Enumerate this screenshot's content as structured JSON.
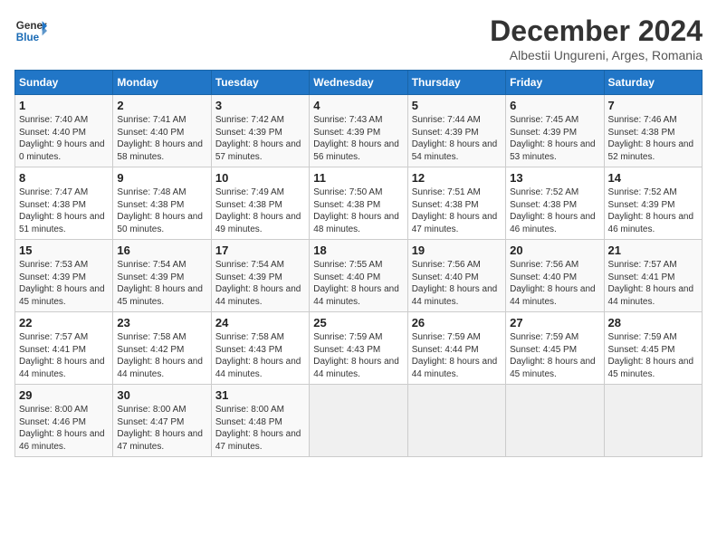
{
  "header": {
    "logo_line1": "General",
    "logo_line2": "Blue",
    "month": "December 2024",
    "location": "Albestii Ungureni, Arges, Romania"
  },
  "columns": [
    "Sunday",
    "Monday",
    "Tuesday",
    "Wednesday",
    "Thursday",
    "Friday",
    "Saturday"
  ],
  "weeks": [
    [
      {
        "day": 1,
        "sunrise": "7:40 AM",
        "sunset": "4:40 PM",
        "daylight": "9 hours and 0 minutes."
      },
      {
        "day": 2,
        "sunrise": "7:41 AM",
        "sunset": "4:40 PM",
        "daylight": "8 hours and 58 minutes."
      },
      {
        "day": 3,
        "sunrise": "7:42 AM",
        "sunset": "4:39 PM",
        "daylight": "8 hours and 57 minutes."
      },
      {
        "day": 4,
        "sunrise": "7:43 AM",
        "sunset": "4:39 PM",
        "daylight": "8 hours and 56 minutes."
      },
      {
        "day": 5,
        "sunrise": "7:44 AM",
        "sunset": "4:39 PM",
        "daylight": "8 hours and 54 minutes."
      },
      {
        "day": 6,
        "sunrise": "7:45 AM",
        "sunset": "4:39 PM",
        "daylight": "8 hours and 53 minutes."
      },
      {
        "day": 7,
        "sunrise": "7:46 AM",
        "sunset": "4:38 PM",
        "daylight": "8 hours and 52 minutes."
      }
    ],
    [
      {
        "day": 8,
        "sunrise": "7:47 AM",
        "sunset": "4:38 PM",
        "daylight": "8 hours and 51 minutes."
      },
      {
        "day": 9,
        "sunrise": "7:48 AM",
        "sunset": "4:38 PM",
        "daylight": "8 hours and 50 minutes."
      },
      {
        "day": 10,
        "sunrise": "7:49 AM",
        "sunset": "4:38 PM",
        "daylight": "8 hours and 49 minutes."
      },
      {
        "day": 11,
        "sunrise": "7:50 AM",
        "sunset": "4:38 PM",
        "daylight": "8 hours and 48 minutes."
      },
      {
        "day": 12,
        "sunrise": "7:51 AM",
        "sunset": "4:38 PM",
        "daylight": "8 hours and 47 minutes."
      },
      {
        "day": 13,
        "sunrise": "7:52 AM",
        "sunset": "4:38 PM",
        "daylight": "8 hours and 46 minutes."
      },
      {
        "day": 14,
        "sunrise": "7:52 AM",
        "sunset": "4:39 PM",
        "daylight": "8 hours and 46 minutes."
      }
    ],
    [
      {
        "day": 15,
        "sunrise": "7:53 AM",
        "sunset": "4:39 PM",
        "daylight": "8 hours and 45 minutes."
      },
      {
        "day": 16,
        "sunrise": "7:54 AM",
        "sunset": "4:39 PM",
        "daylight": "8 hours and 45 minutes."
      },
      {
        "day": 17,
        "sunrise": "7:54 AM",
        "sunset": "4:39 PM",
        "daylight": "8 hours and 44 minutes."
      },
      {
        "day": 18,
        "sunrise": "7:55 AM",
        "sunset": "4:40 PM",
        "daylight": "8 hours and 44 minutes."
      },
      {
        "day": 19,
        "sunrise": "7:56 AM",
        "sunset": "4:40 PM",
        "daylight": "8 hours and 44 minutes."
      },
      {
        "day": 20,
        "sunrise": "7:56 AM",
        "sunset": "4:40 PM",
        "daylight": "8 hours and 44 minutes."
      },
      {
        "day": 21,
        "sunrise": "7:57 AM",
        "sunset": "4:41 PM",
        "daylight": "8 hours and 44 minutes."
      }
    ],
    [
      {
        "day": 22,
        "sunrise": "7:57 AM",
        "sunset": "4:41 PM",
        "daylight": "8 hours and 44 minutes."
      },
      {
        "day": 23,
        "sunrise": "7:58 AM",
        "sunset": "4:42 PM",
        "daylight": "8 hours and 44 minutes."
      },
      {
        "day": 24,
        "sunrise": "7:58 AM",
        "sunset": "4:43 PM",
        "daylight": "8 hours and 44 minutes."
      },
      {
        "day": 25,
        "sunrise": "7:59 AM",
        "sunset": "4:43 PM",
        "daylight": "8 hours and 44 minutes."
      },
      {
        "day": 26,
        "sunrise": "7:59 AM",
        "sunset": "4:44 PM",
        "daylight": "8 hours and 44 minutes."
      },
      {
        "day": 27,
        "sunrise": "7:59 AM",
        "sunset": "4:45 PM",
        "daylight": "8 hours and 45 minutes."
      },
      {
        "day": 28,
        "sunrise": "7:59 AM",
        "sunset": "4:45 PM",
        "daylight": "8 hours and 45 minutes."
      }
    ],
    [
      {
        "day": 29,
        "sunrise": "8:00 AM",
        "sunset": "4:46 PM",
        "daylight": "8 hours and 46 minutes."
      },
      {
        "day": 30,
        "sunrise": "8:00 AM",
        "sunset": "4:47 PM",
        "daylight": "8 hours and 47 minutes."
      },
      {
        "day": 31,
        "sunrise": "8:00 AM",
        "sunset": "4:48 PM",
        "daylight": "8 hours and 47 minutes."
      },
      null,
      null,
      null,
      null
    ]
  ]
}
